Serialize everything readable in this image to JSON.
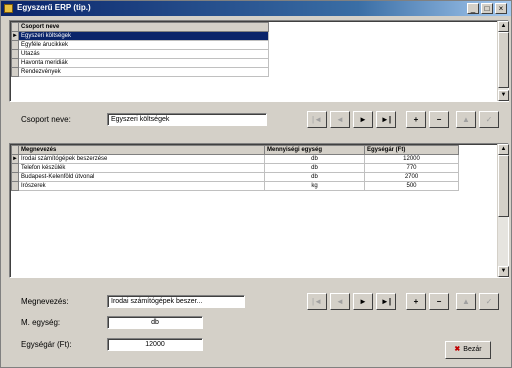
{
  "window": {
    "title": "Egyszerű ERP (tip.)",
    "controls": [
      "_",
      "□",
      "×"
    ]
  },
  "top_grid": {
    "header": "Csoport neve",
    "rows": [
      "Egyszeri költségek",
      "Egyféle árucikkek",
      "Utazás",
      "Havonta meridiák",
      "Rendezvények"
    ],
    "selected_index": 0
  },
  "group_name": {
    "label": "Csoport neve:",
    "value": "Egyszeri költségek"
  },
  "nav_top": {
    "buttons": [
      "|◄",
      "◄",
      "►",
      "►|",
      "+",
      "−",
      "▲",
      "✓"
    ]
  },
  "bottom_grid": {
    "headers": [
      "Megnevezés",
      "Mennyiségi egység",
      "Egységár (Ft)"
    ],
    "rows": [
      [
        "Irodai számítógépek beszerzése",
        "db",
        "12000"
      ],
      [
        "Telefon készülék",
        "db",
        "770"
      ],
      [
        "Budapest-Kelenföld útvonal",
        "db",
        "2700"
      ],
      [
        "Irószerek",
        "kg",
        "500"
      ]
    ],
    "current_row": 0
  },
  "nav_bottom": {
    "buttons": [
      "|◄",
      "◄",
      "►",
      "►|",
      "+",
      "−",
      "▲",
      "✓"
    ]
  },
  "detail": {
    "megnevezes_label": "Megnevezés:",
    "megnevezes_value": "Irodai számítógépek beszer...",
    "unit_label": "M. egység:",
    "unit_value": "db",
    "price_label": "Egységár (Ft):",
    "price_value": "12000"
  },
  "ok_button": {
    "label": "Bezár"
  }
}
